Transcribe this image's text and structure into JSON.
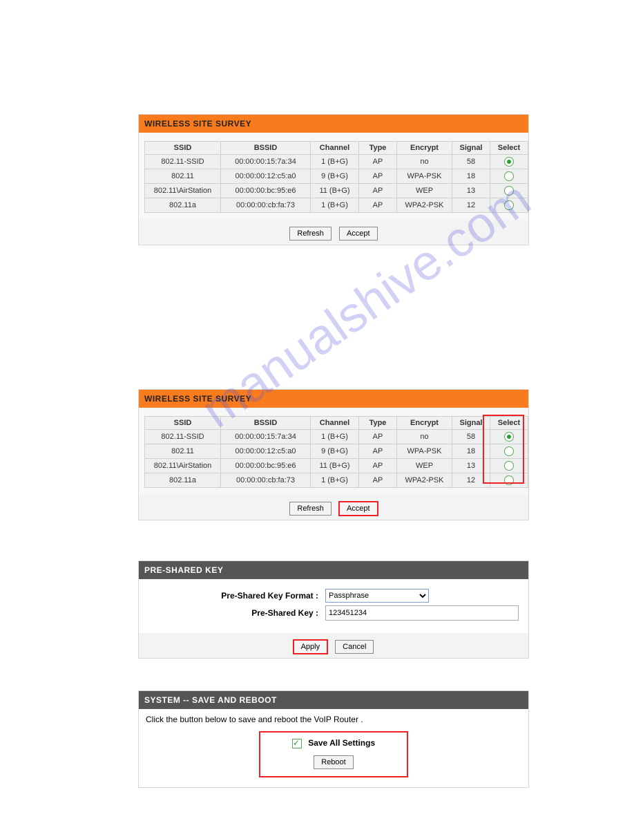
{
  "watermark": "manualshive.com",
  "survey": {
    "title": "WIRELESS SITE SURVEY",
    "headers": {
      "ssid": "SSID",
      "bssid": "BSSID",
      "channel": "Channel",
      "type": "Type",
      "encrypt": "Encrypt",
      "signal": "Signal",
      "select": "Select"
    },
    "rows": [
      {
        "ssid": "802.11-SSID",
        "bssid": "00:00:00:15:7a:34",
        "channel": "1 (B+G)",
        "type": "AP",
        "encrypt": "no",
        "signal": "58",
        "selected": true
      },
      {
        "ssid": "802.11",
        "bssid": "00:00:00:12:c5:a0",
        "channel": "9 (B+G)",
        "type": "AP",
        "encrypt": "WPA-PSK",
        "signal": "18",
        "selected": false
      },
      {
        "ssid": "802.11\\AirStation",
        "bssid": "00:00:00:bc:95:e6",
        "channel": "11 (B+G)",
        "type": "AP",
        "encrypt": "WEP",
        "signal": "13",
        "selected": false
      },
      {
        "ssid": "802.11a",
        "bssid": "00:00:00:cb:fa:73",
        "channel": "1 (B+G)",
        "type": "AP",
        "encrypt": "WPA2-PSK",
        "signal": "12",
        "selected": false
      }
    ],
    "buttons": {
      "refresh": "Refresh",
      "accept": "Accept"
    }
  },
  "psk": {
    "title": "PRE-SHARED KEY",
    "format_label": "Pre-Shared Key Format :",
    "format_value": "Passphrase",
    "key_label": "Pre-Shared Key :",
    "key_value": "123451234",
    "buttons": {
      "apply": "Apply",
      "cancel": "Cancel"
    }
  },
  "system": {
    "title": "SYSTEM -- SAVE AND REBOOT",
    "instruction": "Click the button below to save and reboot the VoIP Router .",
    "save_all_label": "Save All Settings",
    "save_all_checked": true,
    "reboot": "Reboot"
  }
}
